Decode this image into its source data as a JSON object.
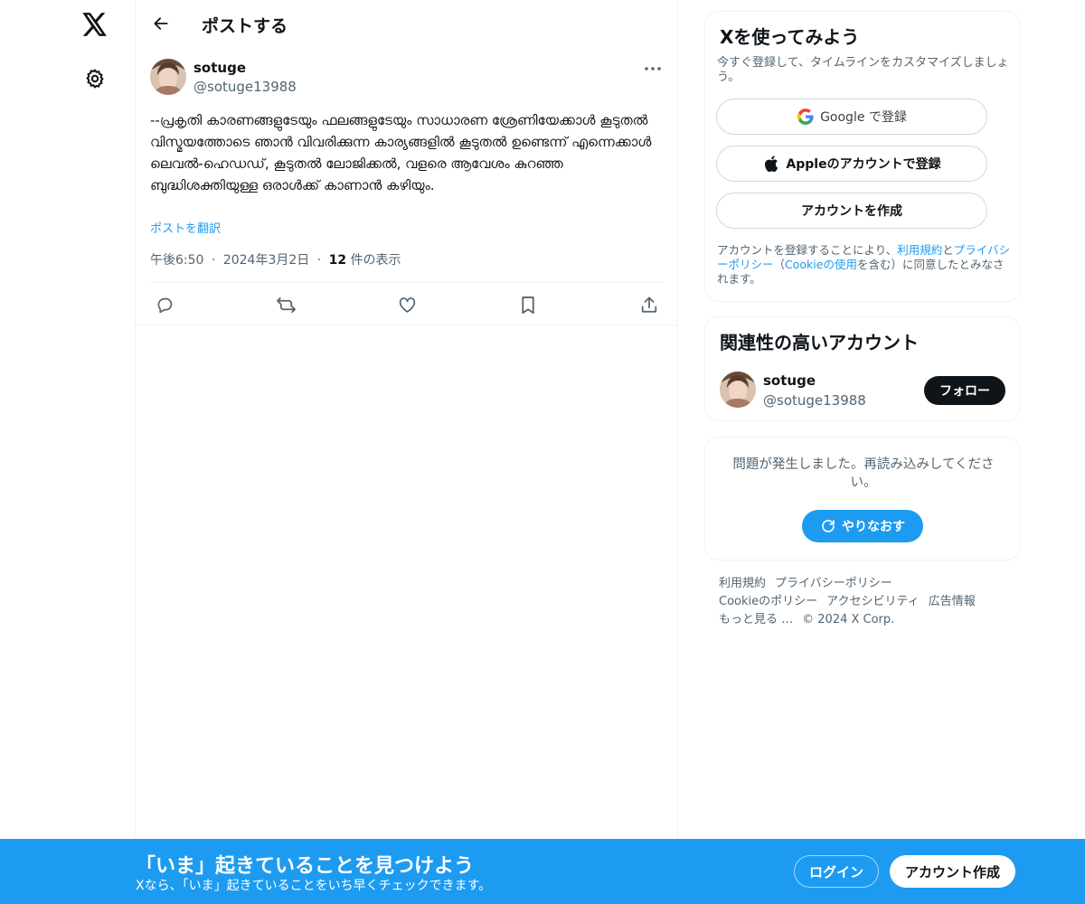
{
  "header": {
    "title": "ポストする"
  },
  "post": {
    "author_name": "sotuge",
    "author_handle": "@sotuge13988",
    "text": "--പ്രകൃതി കാരണങ്ങളുടേയും ഫലങ്ങളുടേയും സാധാരണ ശ്രേണിയേക്കാൾ കൂടുതൽ വിസ്മയത്തോടെ ഞാൻ വിവരിക്കുന്ന കാര്യങ്ങളിൽ കൂടുതൽ ഉണ്ടെന്ന് എന്നെക്കാൾ ലെവൽ-ഹെഡഡ്, കൂടുതൽ ലോജിക്കൽ, വളരെ ആവേശം കുറഞ്ഞ ബുദ്ധിശക്തിയുള്ള ഒരാൾക്ക് കാണാൻ കഴിയും.",
    "translate_label": "ポストを翻訳",
    "time": "午後6:50",
    "date": "2024年3月2日",
    "views_count": "12",
    "views_label": "件の表示",
    "separator": "·"
  },
  "signup": {
    "title": "Xを使ってみよう",
    "description": "今すぐ登録して、タイムラインをカスタマイズしましょう。",
    "google_label": "Google で登録",
    "apple_label": "Appleのアカウントで登録",
    "create_label": "アカウントを作成",
    "terms_1": "アカウントを登録することにより、",
    "terms_link_1": "利用規約",
    "terms_2": "と",
    "terms_link_2": "プライバシーポリシー",
    "terms_3": "（",
    "terms_link_3": "Cookieの使用",
    "terms_4": "を含む）に同意したとみなされます。"
  },
  "related": {
    "title": "関連性の高いアカウント",
    "name": "sotuge",
    "handle": "@sotuge13988",
    "follow_label": "フォロー"
  },
  "error": {
    "message": "問題が発生しました。再読み込みしてください。",
    "retry_label": "やりなおす"
  },
  "footer": {
    "links": [
      "利用規約",
      "プライバシーポリシー",
      "Cookieのポリシー",
      "アクセシビリティ",
      "広告情報",
      "もっと見る …",
      "© 2024 X Corp."
    ]
  },
  "bottom_bar": {
    "title": "「いま」起きていることを見つけよう",
    "subtitle": "Xなら、「いま」起きていることをいち早くチェックできます。",
    "login_label": "ログイン",
    "signup_label": "アカウント作成"
  },
  "colors": {
    "accent": "#1d9bf0",
    "text": "#0f1419",
    "secondary_text": "#536471",
    "border": "#eff3f4"
  },
  "icons": [
    "x-logo-icon",
    "gear-icon",
    "back-arrow-icon",
    "more-icon",
    "reply-icon",
    "repost-icon",
    "like-icon",
    "bookmark-icon",
    "share-icon",
    "google-icon",
    "apple-icon",
    "refresh-icon"
  ]
}
